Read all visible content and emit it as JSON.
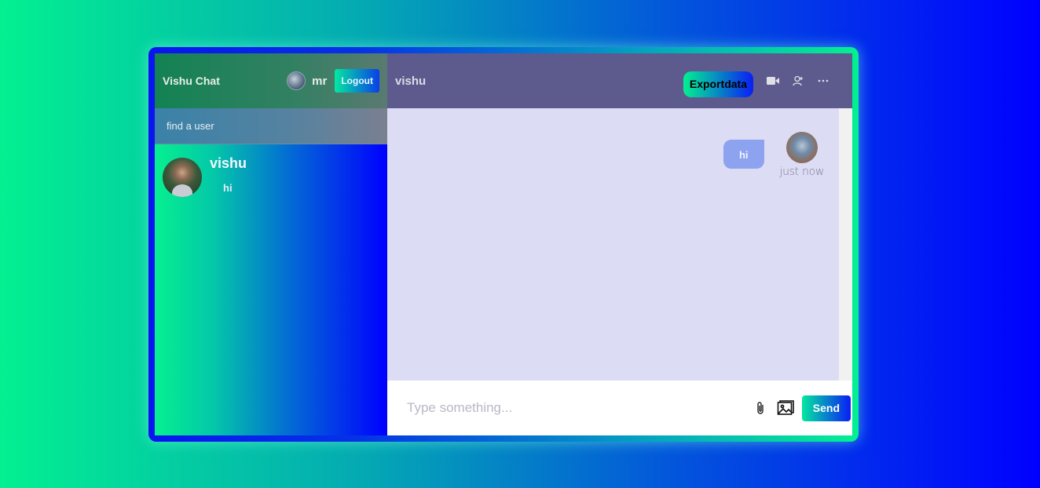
{
  "navbar": {
    "logo": "Vishu Chat",
    "user_name": "mr",
    "logout_label": "Logout"
  },
  "search": {
    "placeholder": "find a user"
  },
  "chats": [
    {
      "name": "vishu",
      "last_message": "hi"
    }
  ],
  "chat": {
    "title": "vishu",
    "export_label": "Exportdata",
    "icons": [
      "video-camera-icon",
      "add-user-icon",
      "more-options-icon"
    ],
    "messages": [
      {
        "text": "hi",
        "time": "just now",
        "owner": true
      }
    ],
    "input_placeholder": "Type something...",
    "send_label": "Send"
  },
  "colors": {
    "header_bg": "#5d5b8d",
    "messages_bg": "#dddcf5",
    "bubble_bg": "#8da3ef",
    "gradient_start": "#03f091",
    "gradient_end": "#0000ff"
  }
}
